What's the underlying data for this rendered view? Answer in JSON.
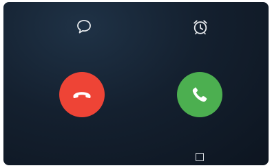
{
  "incoming_call": {
    "quick_actions": [
      {
        "label": "",
        "icon": "message-bubble-icon"
      },
      {
        "label": "",
        "icon": "alarm-clock-icon"
      }
    ],
    "decline": {
      "icon": "phone-hangup-icon",
      "color": "#ee4436"
    },
    "answer": {
      "icon": "phone-icon",
      "color": "#4caf50"
    }
  },
  "nav_bar": {
    "recents_icon": "square-recents-icon"
  }
}
